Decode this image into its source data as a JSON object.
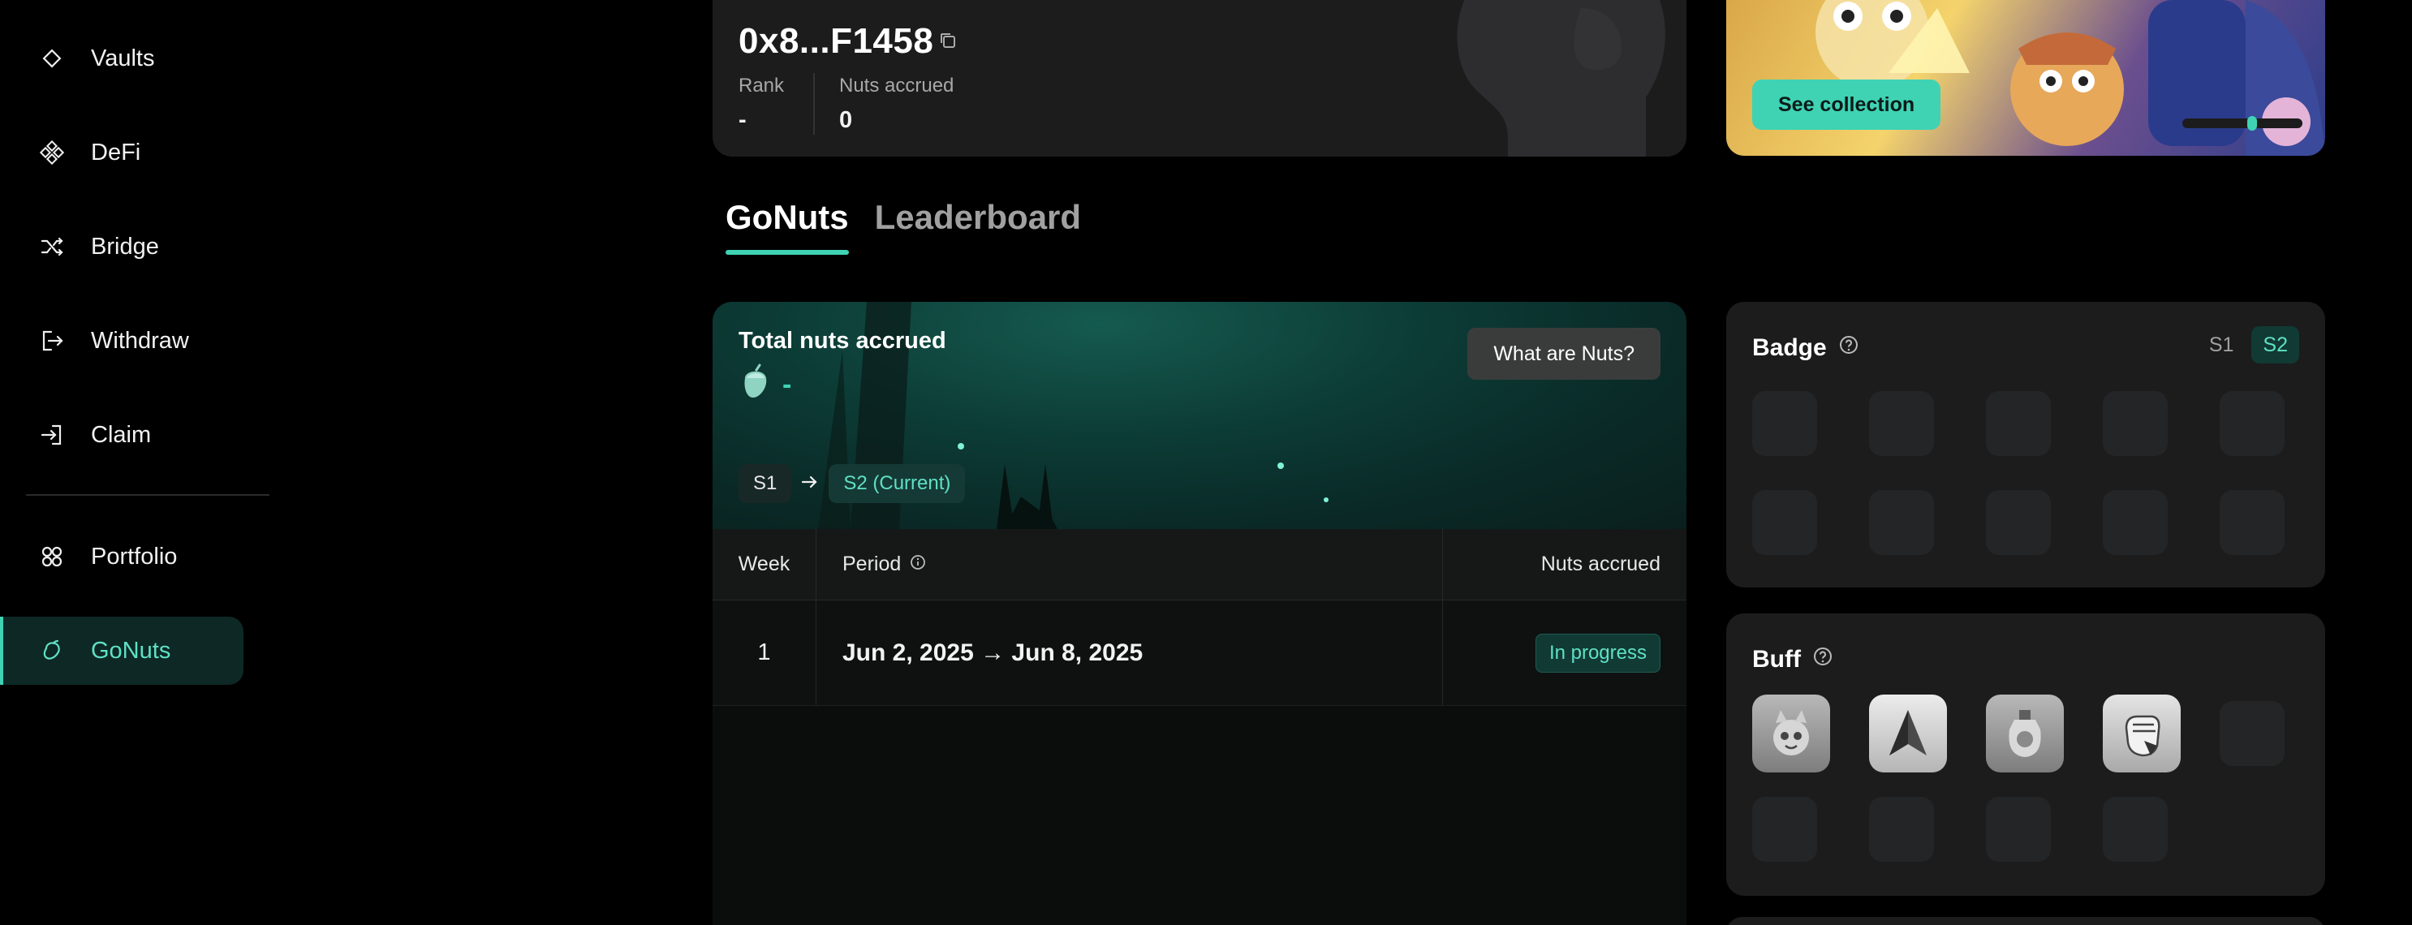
{
  "sidebar": {
    "items": [
      {
        "label": "Vaults",
        "icon": "diamond-icon"
      },
      {
        "label": "DeFi",
        "icon": "defi-icon"
      },
      {
        "label": "Bridge",
        "icon": "shuffle-icon"
      },
      {
        "label": "Withdraw",
        "icon": "withdraw-icon"
      },
      {
        "label": "Claim",
        "icon": "claim-icon"
      },
      {
        "label": "Portfolio",
        "icon": "grid-icon"
      },
      {
        "label": "GoNuts",
        "icon": "nut-icon",
        "active": true
      }
    ]
  },
  "profile": {
    "address": "0x8...F1458",
    "rank_label": "Rank",
    "rank_value": "-",
    "nuts_label": "Nuts accrued",
    "nuts_value": "0"
  },
  "collection": {
    "button_label": "See collection"
  },
  "tabs": [
    {
      "label": "GoNuts",
      "active": true
    },
    {
      "label": "Leaderboard",
      "active": false
    }
  ],
  "hero": {
    "title": "Total nuts accrued",
    "value": "-",
    "what_button": "What are Nuts?",
    "season_from": "S1",
    "season_to": "S2 (Current)"
  },
  "table": {
    "headers": {
      "week": "Week",
      "period": "Period",
      "nuts": "Nuts accrued"
    },
    "rows": [
      {
        "week": "1",
        "period": "Jun 2, 2025 → Jun 8, 2025",
        "status": "In progress"
      }
    ]
  },
  "badge": {
    "title": "Badge",
    "seasons": [
      "S1",
      "S2"
    ],
    "active_season": "S2"
  },
  "buff": {
    "title": "Buff"
  },
  "colors": {
    "accent": "#3fd3b4",
    "background": "#000000",
    "card": "#1c1c1d"
  }
}
